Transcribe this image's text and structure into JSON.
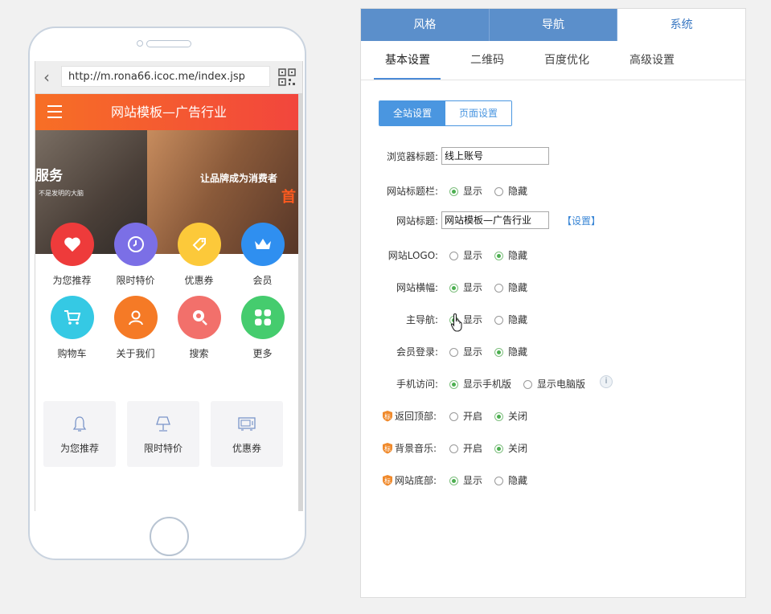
{
  "phone": {
    "url": "http://m.rona66.icoc.me/index.jsp",
    "app_title": "网站模板—广告行业",
    "banner": {
      "text_left": "服务",
      "text_left_sub": "不是发明的大脑",
      "text_right": "让品牌成为消费者",
      "text_right_accent": "首"
    },
    "grid": [
      {
        "label": "为您推荐",
        "icon": "heart-icon",
        "color": "#ee3b3b"
      },
      {
        "label": "限时特价",
        "icon": "clock-icon",
        "color": "#7b6fe6"
      },
      {
        "label": "优惠券",
        "icon": "tag-icon",
        "color": "#fcc93a"
      },
      {
        "label": "会员",
        "icon": "crown-icon",
        "color": "#2f8ff0"
      },
      {
        "label": "购物车",
        "icon": "cart-icon",
        "color": "#35c9e4"
      },
      {
        "label": "关于我们",
        "icon": "people-icon",
        "color": "#f57a26"
      },
      {
        "label": "搜索",
        "icon": "search-icon",
        "color": "#f2706b"
      },
      {
        "label": "更多",
        "icon": "more-icon",
        "color": "#45cc6e"
      }
    ],
    "cards": [
      {
        "label": "为您推荐",
        "icon": "bell-icon"
      },
      {
        "label": "限时特价",
        "icon": "lamp-icon"
      },
      {
        "label": "优惠券",
        "icon": "microwave-icon"
      }
    ]
  },
  "panel": {
    "top_tabs": [
      "风格",
      "导航",
      "系统"
    ],
    "active_top_tab": "系统",
    "sub_tabs": [
      "基本设置",
      "二维码",
      "百度优化",
      "高级设置"
    ],
    "active_sub_tab": "基本设置",
    "segment": [
      "全站设置",
      "页面设置"
    ],
    "browser_title": {
      "label": "浏览器标题:",
      "value": "线上账号"
    },
    "site_title_bar": {
      "label": "网站标题栏:",
      "options": [
        "显示",
        "隐藏"
      ],
      "selected": "显示"
    },
    "site_title": {
      "label": "网站标题:",
      "value": "网站模板—广告行业",
      "link": "【设置】"
    },
    "site_logo": {
      "label": "网站LOGO:",
      "options": [
        "显示",
        "隐藏"
      ],
      "selected": "隐藏"
    },
    "site_banner": {
      "label": "网站横幅:",
      "options": [
        "显示",
        "隐藏"
      ],
      "selected": "显示"
    },
    "main_nav": {
      "label": "主导航:",
      "options": [
        "显示",
        "隐藏"
      ],
      "selected": "显示"
    },
    "member_login": {
      "label": "会员登录:",
      "options": [
        "显示",
        "隐藏"
      ],
      "selected": "隐藏"
    },
    "mobile_access": {
      "label": "手机访问:",
      "options": [
        "显示手机版",
        "显示电脑版"
      ],
      "selected": "显示手机版",
      "info": "i"
    },
    "back_to_top": {
      "label": "返回顶部:",
      "options": [
        "开启",
        "关闭"
      ],
      "selected": "关闭"
    },
    "bg_music": {
      "label": "背景音乐:",
      "options": [
        "开启",
        "关闭"
      ],
      "selected": "关闭"
    },
    "site_footer": {
      "label": "网站底部:",
      "options": [
        "显示",
        "隐藏"
      ],
      "selected": "显示"
    }
  },
  "colors": {
    "accent": "#4a96e0",
    "tab_blue": "#5b8fcb",
    "header_orange": "#f76f25",
    "radio_green": "#4caf50"
  }
}
